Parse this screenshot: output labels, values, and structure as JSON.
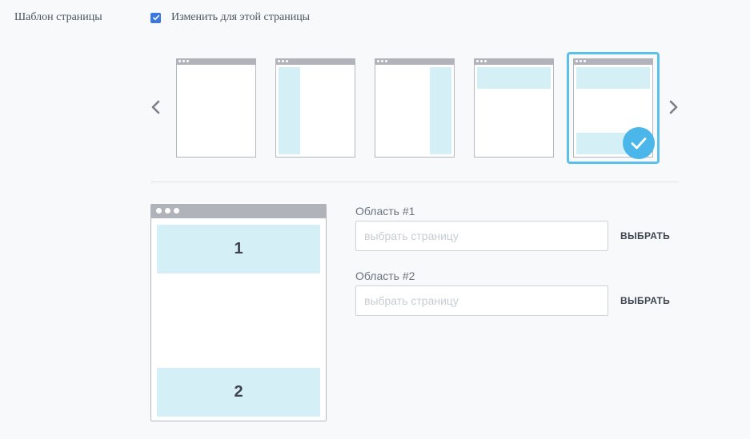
{
  "template_row": {
    "label": "Шаблон страницы",
    "override_label": "Изменить для этой страницы",
    "override_checked": true
  },
  "carousel": {
    "prev_icon": "chevron-left-icon",
    "next_icon": "chevron-right-icon",
    "selected_index": 4,
    "layouts": [
      "blank",
      "left-sidebar",
      "right-sidebar",
      "header",
      "header-footer"
    ]
  },
  "preview": {
    "region_1": "1",
    "region_2": "2"
  },
  "fields": [
    {
      "label": "Область #1",
      "placeholder": "выбрать страницу",
      "value": "",
      "button": "ВЫБРАТЬ"
    },
    {
      "label": "Область #2",
      "placeholder": "выбрать страницу",
      "value": "",
      "button": "ВЫБРАТЬ"
    }
  ],
  "colors": {
    "accent": "#4bb6ea",
    "checkbox": "#3a78e0",
    "region": "#d4f0f6"
  }
}
